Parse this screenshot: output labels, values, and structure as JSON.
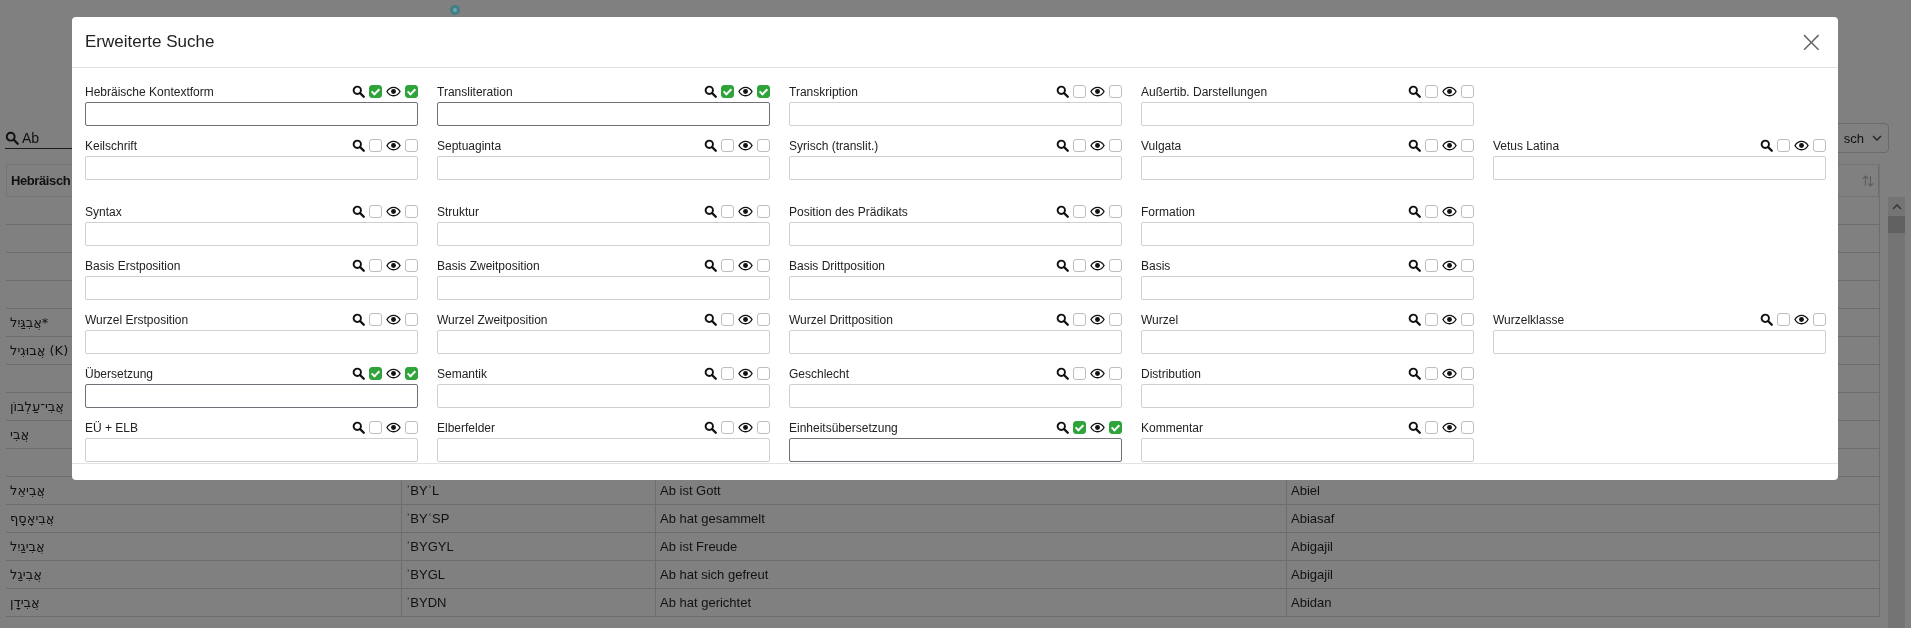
{
  "background": {
    "search": {
      "value": "Ab"
    },
    "select": {
      "value": "sch"
    },
    "table": {
      "header": "Hebräisch",
      "rows": [
        {
          "hebrew": ""
        },
        {
          "hebrew": ""
        },
        {
          "hebrew": ""
        },
        {
          "hebrew": ""
        },
        {
          "hebrew": "אֲבִגַּיִל*"
        },
        {
          "hebrew": "אֲבוּגִיל (K)"
        },
        {
          "hebrew": ""
        },
        {
          "hebrew": "אֲבִי־עַלְבוֹן"
        },
        {
          "hebrew": "אֲבִי"
        },
        {
          "hebrew": ""
        },
        {
          "hebrew": "אֲבִיאֵל",
          "translit": "ʾBYʾL",
          "meaning": "Ab ist Gott",
          "name": "Abiel"
        },
        {
          "hebrew": "אֲבִיאָסָף",
          "translit": "ʾBYʿSP",
          "meaning": "Ab hat gesammelt",
          "name": "Abiasaf"
        },
        {
          "hebrew": "אֲבִיגַיִל",
          "translit": "ʾBYGYL",
          "meaning": "Ab ist Freude",
          "name": "Abigajil"
        },
        {
          "hebrew": "אֲבִיגַל",
          "translit": "ʾBYGL",
          "meaning": "Ab hat sich gefreut",
          "name": "Abigajil"
        },
        {
          "hebrew": "אֲבִידָן",
          "translit": "ʾBYDN",
          "meaning": "Ab hat gerichtet",
          "name": "Abidan"
        }
      ]
    }
  },
  "modal": {
    "title": "Erweiterte Suche",
    "close": "×",
    "rows": [
      [
        {
          "label": "Hebräische Kontextform",
          "search_checked": true,
          "show_checked": true
        },
        {
          "label": "Transliteration",
          "search_checked": true,
          "show_checked": true
        },
        {
          "label": "Transkription",
          "search_checked": false,
          "show_checked": false
        },
        {
          "label": "Außertib. Darstellungen",
          "search_checked": false,
          "show_checked": false
        },
        null
      ],
      [
        {
          "label": "Keilschrift",
          "search_checked": false,
          "show_checked": false
        },
        {
          "label": "Septuaginta",
          "search_checked": false,
          "show_checked": false
        },
        {
          "label": "Syrisch (translit.)",
          "search_checked": false,
          "show_checked": false
        },
        {
          "label": "Vulgata",
          "search_checked": false,
          "show_checked": false
        },
        {
          "label": "Vetus Latina",
          "search_checked": false,
          "show_checked": false
        }
      ],
      [
        {
          "label": "Syntax",
          "search_checked": false,
          "show_checked": false
        },
        {
          "label": "Struktur",
          "search_checked": false,
          "show_checked": false
        },
        {
          "label": "Position des Prädikats",
          "search_checked": false,
          "show_checked": false
        },
        {
          "label": "Formation",
          "search_checked": false,
          "show_checked": false
        },
        null
      ],
      [
        {
          "label": "Basis Erstposition",
          "search_checked": false,
          "show_checked": false
        },
        {
          "label": "Basis Zweitposition",
          "search_checked": false,
          "show_checked": false
        },
        {
          "label": "Basis Drittposition",
          "search_checked": false,
          "show_checked": false
        },
        {
          "label": "Basis",
          "search_checked": false,
          "show_checked": false
        },
        null
      ],
      [
        {
          "label": "Wurzel Erstposition",
          "search_checked": false,
          "show_checked": false
        },
        {
          "label": "Wurzel Zweitposition",
          "search_checked": false,
          "show_checked": false
        },
        {
          "label": "Wurzel Drittposition",
          "search_checked": false,
          "show_checked": false
        },
        {
          "label": "Wurzel",
          "search_checked": false,
          "show_checked": false
        },
        {
          "label": "Wurzelklasse",
          "search_checked": false,
          "show_checked": false
        }
      ],
      [
        {
          "label": "Übersetzung",
          "search_checked": true,
          "show_checked": true
        },
        {
          "label": "Semantik",
          "search_checked": false,
          "show_checked": false
        },
        {
          "label": "Geschlecht",
          "search_checked": false,
          "show_checked": false
        },
        {
          "label": "Distribution",
          "search_checked": false,
          "show_checked": false
        },
        null
      ],
      [
        {
          "label": "EÜ + ELB",
          "search_checked": false,
          "show_checked": false
        },
        {
          "label": "Elberfelder",
          "search_checked": false,
          "show_checked": false
        },
        {
          "label": "Einheitsübersetzung",
          "search_checked": true,
          "show_checked": true
        },
        {
          "label": "Kommentar",
          "search_checked": false,
          "show_checked": false
        },
        null
      ]
    ]
  }
}
